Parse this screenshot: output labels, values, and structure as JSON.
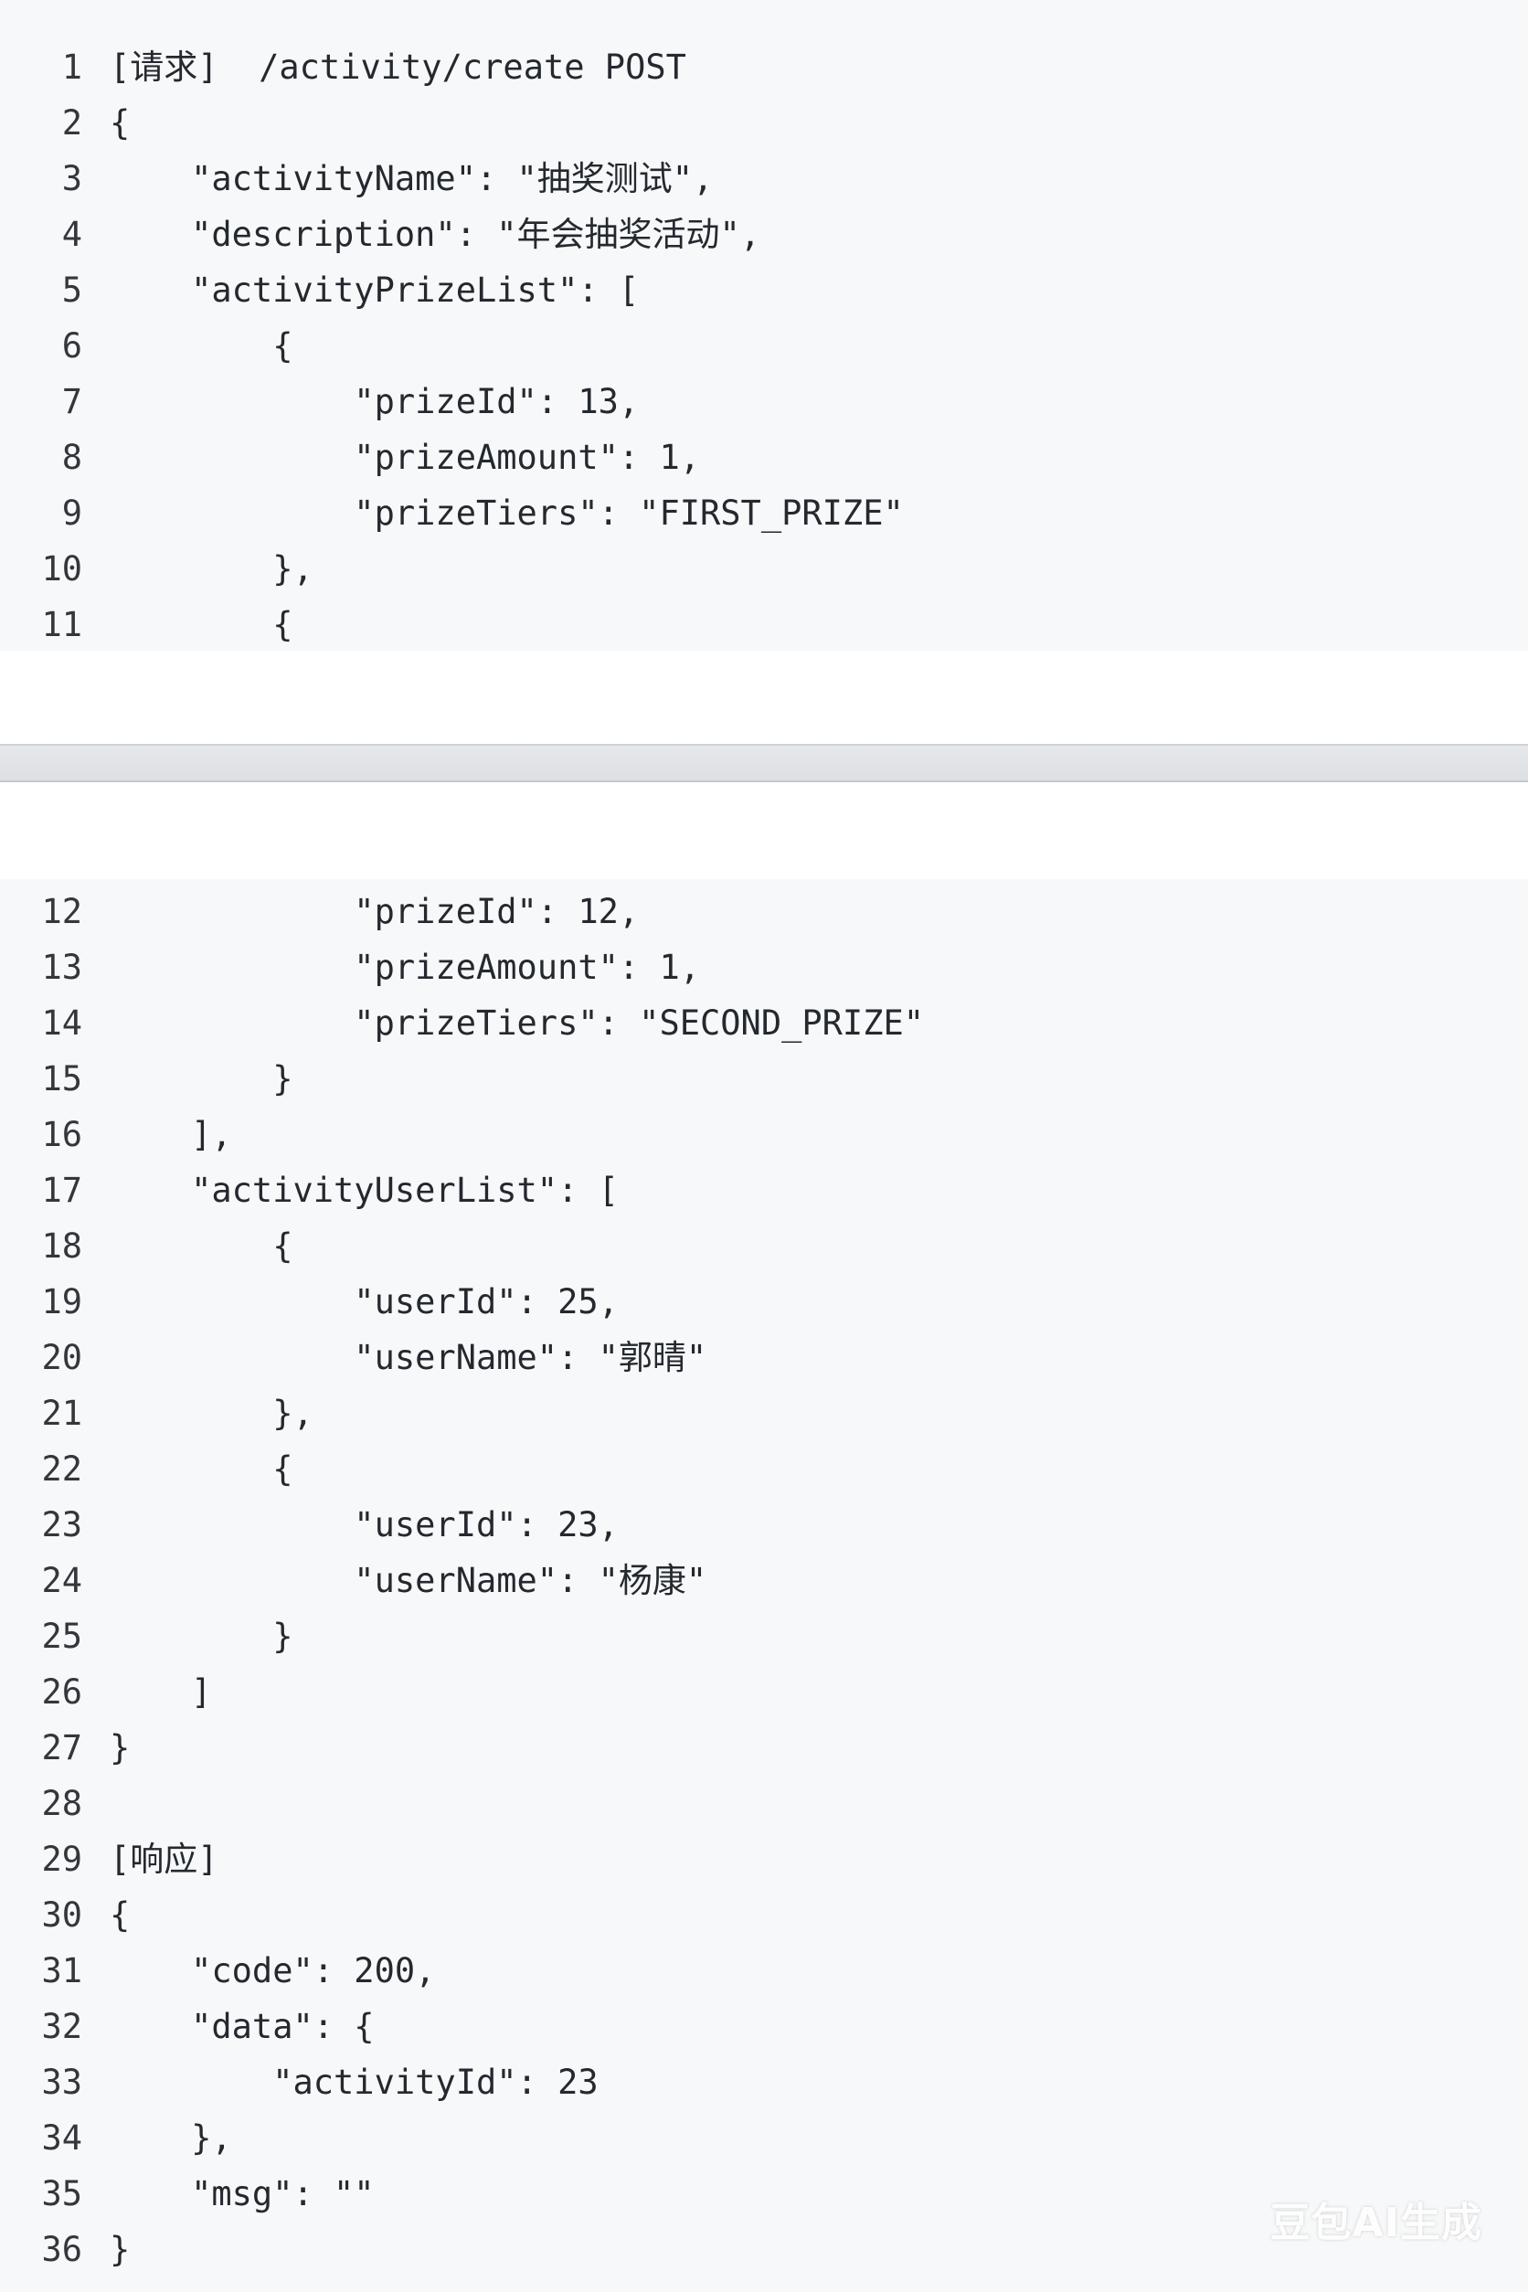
{
  "code_blocks": [
    {
      "lines": [
        {
          "number": "1",
          "text": "[请求]  /activity/create POST"
        },
        {
          "number": "2",
          "text": "{"
        },
        {
          "number": "3",
          "text": "    \"activityName\": \"抽奖测试\","
        },
        {
          "number": "4",
          "text": "    \"description\": \"年会抽奖活动\","
        },
        {
          "number": "5",
          "text": "    \"activityPrizeList\": ["
        },
        {
          "number": "6",
          "text": "        {"
        },
        {
          "number": "7",
          "text": "            \"prizeId\": 13,"
        },
        {
          "number": "8",
          "text": "            \"prizeAmount\": 1,"
        },
        {
          "number": "9",
          "text": "            \"prizeTiers\": \"FIRST_PRIZE\""
        },
        {
          "number": "10",
          "text": "        },"
        },
        {
          "number": "11",
          "text": "        {"
        }
      ]
    },
    {
      "lines": [
        {
          "number": "12",
          "text": "            \"prizeId\": 12,"
        },
        {
          "number": "13",
          "text": "            \"prizeAmount\": 1,"
        },
        {
          "number": "14",
          "text": "            \"prizeTiers\": \"SECOND_PRIZE\""
        },
        {
          "number": "15",
          "text": "        }"
        },
        {
          "number": "16",
          "text": "    ],"
        },
        {
          "number": "17",
          "text": "    \"activityUserList\": ["
        },
        {
          "number": "18",
          "text": "        {"
        },
        {
          "number": "19",
          "text": "            \"userId\": 25,"
        },
        {
          "number": "20",
          "text": "            \"userName\": \"郭晴\""
        },
        {
          "number": "21",
          "text": "        },"
        },
        {
          "number": "22",
          "text": "        {"
        },
        {
          "number": "23",
          "text": "            \"userId\": 23,"
        },
        {
          "number": "24",
          "text": "            \"userName\": \"杨康\""
        },
        {
          "number": "25",
          "text": "        }"
        },
        {
          "number": "26",
          "text": "    ]"
        },
        {
          "number": "27",
          "text": "}"
        },
        {
          "number": "28",
          "text": ""
        },
        {
          "number": "29",
          "text": "[响应]"
        },
        {
          "number": "30",
          "text": "{"
        },
        {
          "number": "31",
          "text": "    \"code\": 200,"
        },
        {
          "number": "32",
          "text": "    \"data\": {"
        },
        {
          "number": "33",
          "text": "        \"activityId\": 23"
        },
        {
          "number": "34",
          "text": "    },"
        },
        {
          "number": "35",
          "text": "    \"msg\": \"\""
        },
        {
          "number": "36",
          "text": "}"
        }
      ]
    }
  ],
  "watermark": "豆包AI生成",
  "colors": {
    "code_background": "#f7f8f9",
    "text": "#24292f",
    "separator": "#dcdfe3"
  }
}
